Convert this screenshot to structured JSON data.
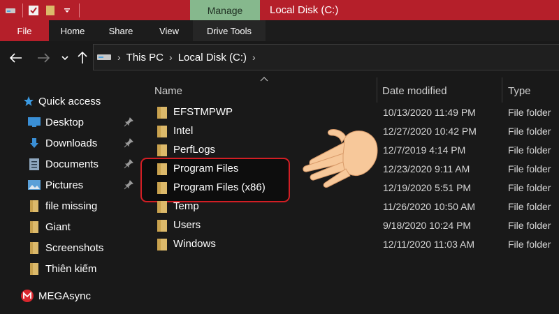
{
  "titlebar": {
    "manage_label": "Manage",
    "window_title": "Local Disk (C:)"
  },
  "ribbon": {
    "tabs": [
      {
        "label": "File"
      },
      {
        "label": "Home"
      },
      {
        "label": "Share"
      },
      {
        "label": "View"
      },
      {
        "label": "Drive Tools"
      }
    ]
  },
  "address": {
    "crumbs": [
      "This PC",
      "Local Disk (C:)"
    ]
  },
  "sidebar": {
    "quick_access": "Quick access",
    "items": [
      {
        "label": "Desktop",
        "icon": "desktop-icon",
        "pinned": true
      },
      {
        "label": "Downloads",
        "icon": "downloads-icon",
        "pinned": true
      },
      {
        "label": "Documents",
        "icon": "documents-icon",
        "pinned": true
      },
      {
        "label": "Pictures",
        "icon": "pictures-icon",
        "pinned": true
      },
      {
        "label": "file missing",
        "icon": "folder-icon",
        "pinned": false
      },
      {
        "label": "Giant",
        "icon": "folder-icon",
        "pinned": false
      },
      {
        "label": "Screenshots",
        "icon": "folder-icon",
        "pinned": false
      },
      {
        "label": "Thiên kiếm",
        "icon": "folder-icon",
        "pinned": false
      }
    ],
    "mega": "MEGAsync"
  },
  "columns": {
    "name": "Name",
    "date": "Date modified",
    "type": "Type"
  },
  "files": [
    {
      "name": "EFSTMPWP",
      "date": "10/13/2020 11:49 PM",
      "type": "File folder"
    },
    {
      "name": "Intel",
      "date": "12/27/2020 10:42 PM",
      "type": "File folder"
    },
    {
      "name": "PerfLogs",
      "date": "12/7/2019 4:14 PM",
      "type": "File folder"
    },
    {
      "name": "Program Files",
      "date": "12/23/2020 9:11 AM",
      "type": "File folder"
    },
    {
      "name": "Program Files (x86)",
      "date": "12/19/2020 5:51 PM",
      "type": "File folder"
    },
    {
      "name": "Temp",
      "date": "11/26/2020 10:50 AM",
      "type": "File folder"
    },
    {
      "name": "Users",
      "date": "9/18/2020 10:24 PM",
      "type": "File folder"
    },
    {
      "name": "Windows",
      "date": "12/11/2020 11:03 AM",
      "type": "File folder"
    }
  ],
  "colors": {
    "titlebar": "#b51f2a",
    "manage_tab": "#86b88d",
    "highlight": "#d21e24",
    "folder": "#dcb96a"
  }
}
